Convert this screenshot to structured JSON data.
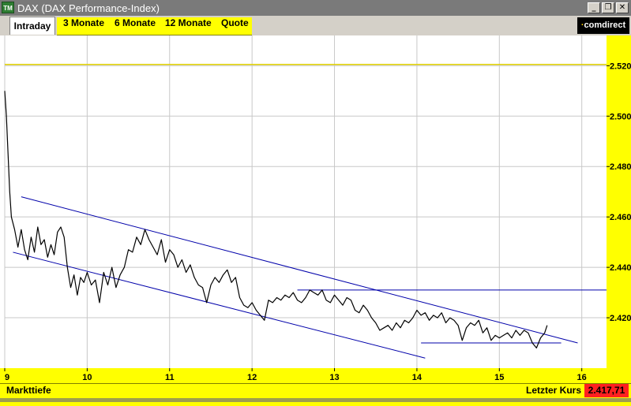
{
  "window": {
    "title": "DAX (DAX Performance-Index)",
    "app_icon_label": "TM",
    "buttons": {
      "minimize": "_",
      "restore": "❐",
      "close": "✕"
    }
  },
  "tabs": {
    "active": "Intraday",
    "items": [
      "3 Monate",
      "6 Monate",
      "12 Monate",
      "Quote"
    ]
  },
  "brand": {
    "logo_text": "comdirect"
  },
  "colors": {
    "yellow": "#ffff00",
    "price_line": "#000000",
    "trend_lines": "#0000aa",
    "reference_line": "#e0d000",
    "grid": "#c8c8c8",
    "last_price_bg": "#ff2020"
  },
  "status": {
    "left_label": "Markttiefe",
    "last_price_label": "Letzter Kurs",
    "last_price_value": "2.417,71"
  },
  "chart_data": {
    "type": "line",
    "x_ticks": [
      "9",
      "10",
      "11",
      "12",
      "13",
      "14",
      "15",
      "16"
    ],
    "y_ticks": [
      "2.420",
      "2.440",
      "2.460",
      "2.480",
      "2.500",
      "2.520"
    ],
    "xlim": [
      9.0,
      16.3
    ],
    "ylim": [
      2400,
      2532
    ],
    "grid": true,
    "reference_line": 2520.5,
    "series": [
      {
        "points": [
          [
            9.0,
            2510
          ],
          [
            9.02,
            2500
          ],
          [
            9.04,
            2485
          ],
          [
            9.06,
            2470
          ],
          [
            9.08,
            2460
          ],
          [
            9.12,
            2455
          ],
          [
            9.16,
            2448
          ],
          [
            9.2,
            2455
          ],
          [
            9.24,
            2447
          ],
          [
            9.28,
            2443
          ],
          [
            9.32,
            2452
          ],
          [
            9.36,
            2446
          ],
          [
            9.4,
            2456
          ],
          [
            9.44,
            2449
          ],
          [
            9.48,
            2451
          ],
          [
            9.52,
            2444
          ],
          [
            9.56,
            2449
          ],
          [
            9.6,
            2445
          ],
          [
            9.64,
            2454
          ],
          [
            9.68,
            2456
          ],
          [
            9.72,
            2452
          ],
          [
            9.76,
            2440
          ],
          [
            9.8,
            2432
          ],
          [
            9.84,
            2437
          ],
          [
            9.88,
            2429
          ],
          [
            9.92,
            2436
          ],
          [
            9.96,
            2434
          ],
          [
            10.0,
            2438
          ],
          [
            10.05,
            2433
          ],
          [
            10.1,
            2435
          ],
          [
            10.15,
            2426
          ],
          [
            10.2,
            2438
          ],
          [
            10.25,
            2433
          ],
          [
            10.3,
            2440
          ],
          [
            10.35,
            2432
          ],
          [
            10.4,
            2437
          ],
          [
            10.45,
            2440
          ],
          [
            10.5,
            2447
          ],
          [
            10.55,
            2446
          ],
          [
            10.6,
            2452
          ],
          [
            10.65,
            2449
          ],
          [
            10.7,
            2455
          ],
          [
            10.75,
            2451
          ],
          [
            10.8,
            2448
          ],
          [
            10.85,
            2445
          ],
          [
            10.9,
            2451
          ],
          [
            10.95,
            2442
          ],
          [
            11.0,
            2447
          ],
          [
            11.05,
            2445
          ],
          [
            11.1,
            2440
          ],
          [
            11.15,
            2443
          ],
          [
            11.2,
            2438
          ],
          [
            11.25,
            2441
          ],
          [
            11.3,
            2436
          ],
          [
            11.35,
            2433
          ],
          [
            11.4,
            2432
          ],
          [
            11.45,
            2426
          ],
          [
            11.5,
            2433
          ],
          [
            11.55,
            2436
          ],
          [
            11.6,
            2434
          ],
          [
            11.65,
            2437
          ],
          [
            11.7,
            2439
          ],
          [
            11.75,
            2434
          ],
          [
            11.8,
            2436
          ],
          [
            11.85,
            2428
          ],
          [
            11.9,
            2425
          ],
          [
            11.95,
            2424
          ],
          [
            12.0,
            2426
          ],
          [
            12.05,
            2423
          ],
          [
            12.1,
            2421
          ],
          [
            12.15,
            2419
          ],
          [
            12.2,
            2427
          ],
          [
            12.25,
            2426
          ],
          [
            12.3,
            2428
          ],
          [
            12.35,
            2427
          ],
          [
            12.4,
            2429
          ],
          [
            12.45,
            2428
          ],
          [
            12.5,
            2430
          ],
          [
            12.55,
            2427
          ],
          [
            12.6,
            2426
          ],
          [
            12.65,
            2428
          ],
          [
            12.7,
            2431
          ],
          [
            12.75,
            2430
          ],
          [
            12.8,
            2429
          ],
          [
            12.85,
            2431
          ],
          [
            12.9,
            2427
          ],
          [
            12.95,
            2426
          ],
          [
            13.0,
            2429
          ],
          [
            13.05,
            2427
          ],
          [
            13.1,
            2425
          ],
          [
            13.15,
            2428
          ],
          [
            13.2,
            2427
          ],
          [
            13.25,
            2423
          ],
          [
            13.3,
            2422
          ],
          [
            13.35,
            2425
          ],
          [
            13.4,
            2423
          ],
          [
            13.45,
            2420
          ],
          [
            13.5,
            2418
          ],
          [
            13.55,
            2415
          ],
          [
            13.6,
            2416
          ],
          [
            13.65,
            2417
          ],
          [
            13.7,
            2415
          ],
          [
            13.75,
            2418
          ],
          [
            13.8,
            2416
          ],
          [
            13.85,
            2419
          ],
          [
            13.9,
            2418
          ],
          [
            13.95,
            2420
          ],
          [
            14.0,
            2423
          ],
          [
            14.05,
            2421
          ],
          [
            14.1,
            2422
          ],
          [
            14.15,
            2419
          ],
          [
            14.2,
            2421
          ],
          [
            14.25,
            2420
          ],
          [
            14.3,
            2422
          ],
          [
            14.35,
            2418
          ],
          [
            14.4,
            2420
          ],
          [
            14.45,
            2419
          ],
          [
            14.5,
            2417
          ],
          [
            14.55,
            2411
          ],
          [
            14.6,
            2416
          ],
          [
            14.65,
            2418
          ],
          [
            14.7,
            2417
          ],
          [
            14.75,
            2419
          ],
          [
            14.8,
            2414
          ],
          [
            14.85,
            2416
          ],
          [
            14.9,
            2411
          ],
          [
            14.95,
            2413
          ],
          [
            15.0,
            2412
          ],
          [
            15.05,
            2413
          ],
          [
            15.1,
            2414
          ],
          [
            15.15,
            2412
          ],
          [
            15.2,
            2415
          ],
          [
            15.25,
            2413
          ],
          [
            15.3,
            2415
          ],
          [
            15.35,
            2414
          ],
          [
            15.4,
            2410
          ],
          [
            15.45,
            2408
          ],
          [
            15.5,
            2412
          ],
          [
            15.55,
            2414
          ],
          [
            15.58,
            2417
          ]
        ]
      }
    ],
    "trend_lines": [
      {
        "from": [
          9.2,
          2468
        ],
        "to": [
          15.95,
          2410
        ]
      },
      {
        "from": [
          9.1,
          2446
        ],
        "to": [
          14.1,
          2404
        ]
      },
      {
        "from": [
          12.55,
          2431
        ],
        "to": [
          16.3,
          2431
        ]
      },
      {
        "from": [
          14.05,
          2410
        ],
        "to": [
          15.75,
          2410
        ]
      }
    ]
  }
}
